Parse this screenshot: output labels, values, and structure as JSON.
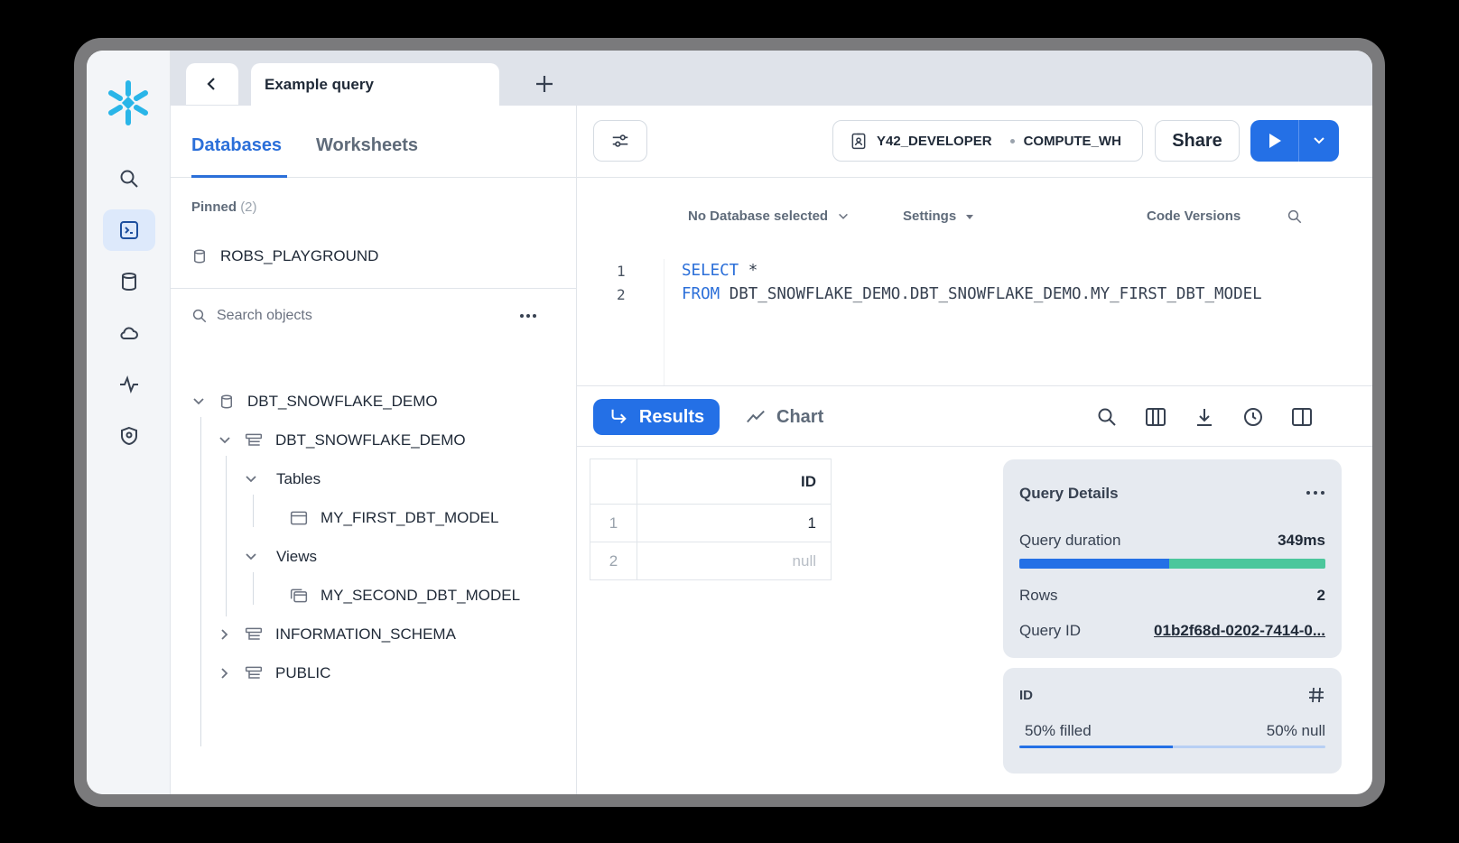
{
  "tabs": {
    "active": "Example query"
  },
  "left_panel": {
    "tabs": [
      "Databases",
      "Worksheets"
    ],
    "pinned_label": "Pinned",
    "pinned_count": "(2)",
    "pinned_items": [
      "ROBS_PLAYGROUND"
    ],
    "search_placeholder": "Search objects",
    "tree": {
      "db": "DBT_SNOWFLAKE_DEMO",
      "schema": "DBT_SNOWFLAKE_DEMO",
      "tables_label": "Tables",
      "table": "MY_FIRST_DBT_MODEL",
      "views_label": "Views",
      "view": "MY_SECOND_DBT_MODEL",
      "schema2": "INFORMATION_SCHEMA",
      "schema3": "PUBLIC"
    }
  },
  "toolbar": {
    "role": "Y42_DEVELOPER",
    "warehouse": "COMPUTE_WH",
    "share": "Share"
  },
  "editor": {
    "database": "No Database selected",
    "settings": "Settings",
    "code_versions": "Code Versions",
    "lines": [
      {
        "n": "1",
        "kw": "SELECT",
        "rest": " *"
      },
      {
        "n": "2",
        "kw": "FROM",
        "rest": " DBT_SNOWFLAKE_DEMO.DBT_SNOWFLAKE_DEMO.MY_FIRST_DBT_MODEL"
      }
    ]
  },
  "results": {
    "results_label": "Results",
    "chart_label": "Chart",
    "column": "ID",
    "rows": [
      {
        "n": "1",
        "v": "1"
      },
      {
        "n": "2",
        "v": "null"
      }
    ]
  },
  "details": {
    "title": "Query Details",
    "duration_label": "Query duration",
    "duration": "349ms",
    "rows_label": "Rows",
    "rows": "2",
    "id_label": "Query ID",
    "id": "01b2f68d-0202-7414-0...",
    "col_title": "ID",
    "filled": "50% filled",
    "null": "50% null",
    "filled_fraction": 0.5
  },
  "colors": {
    "accent": "#2470e6",
    "green": "#4cc79c"
  }
}
